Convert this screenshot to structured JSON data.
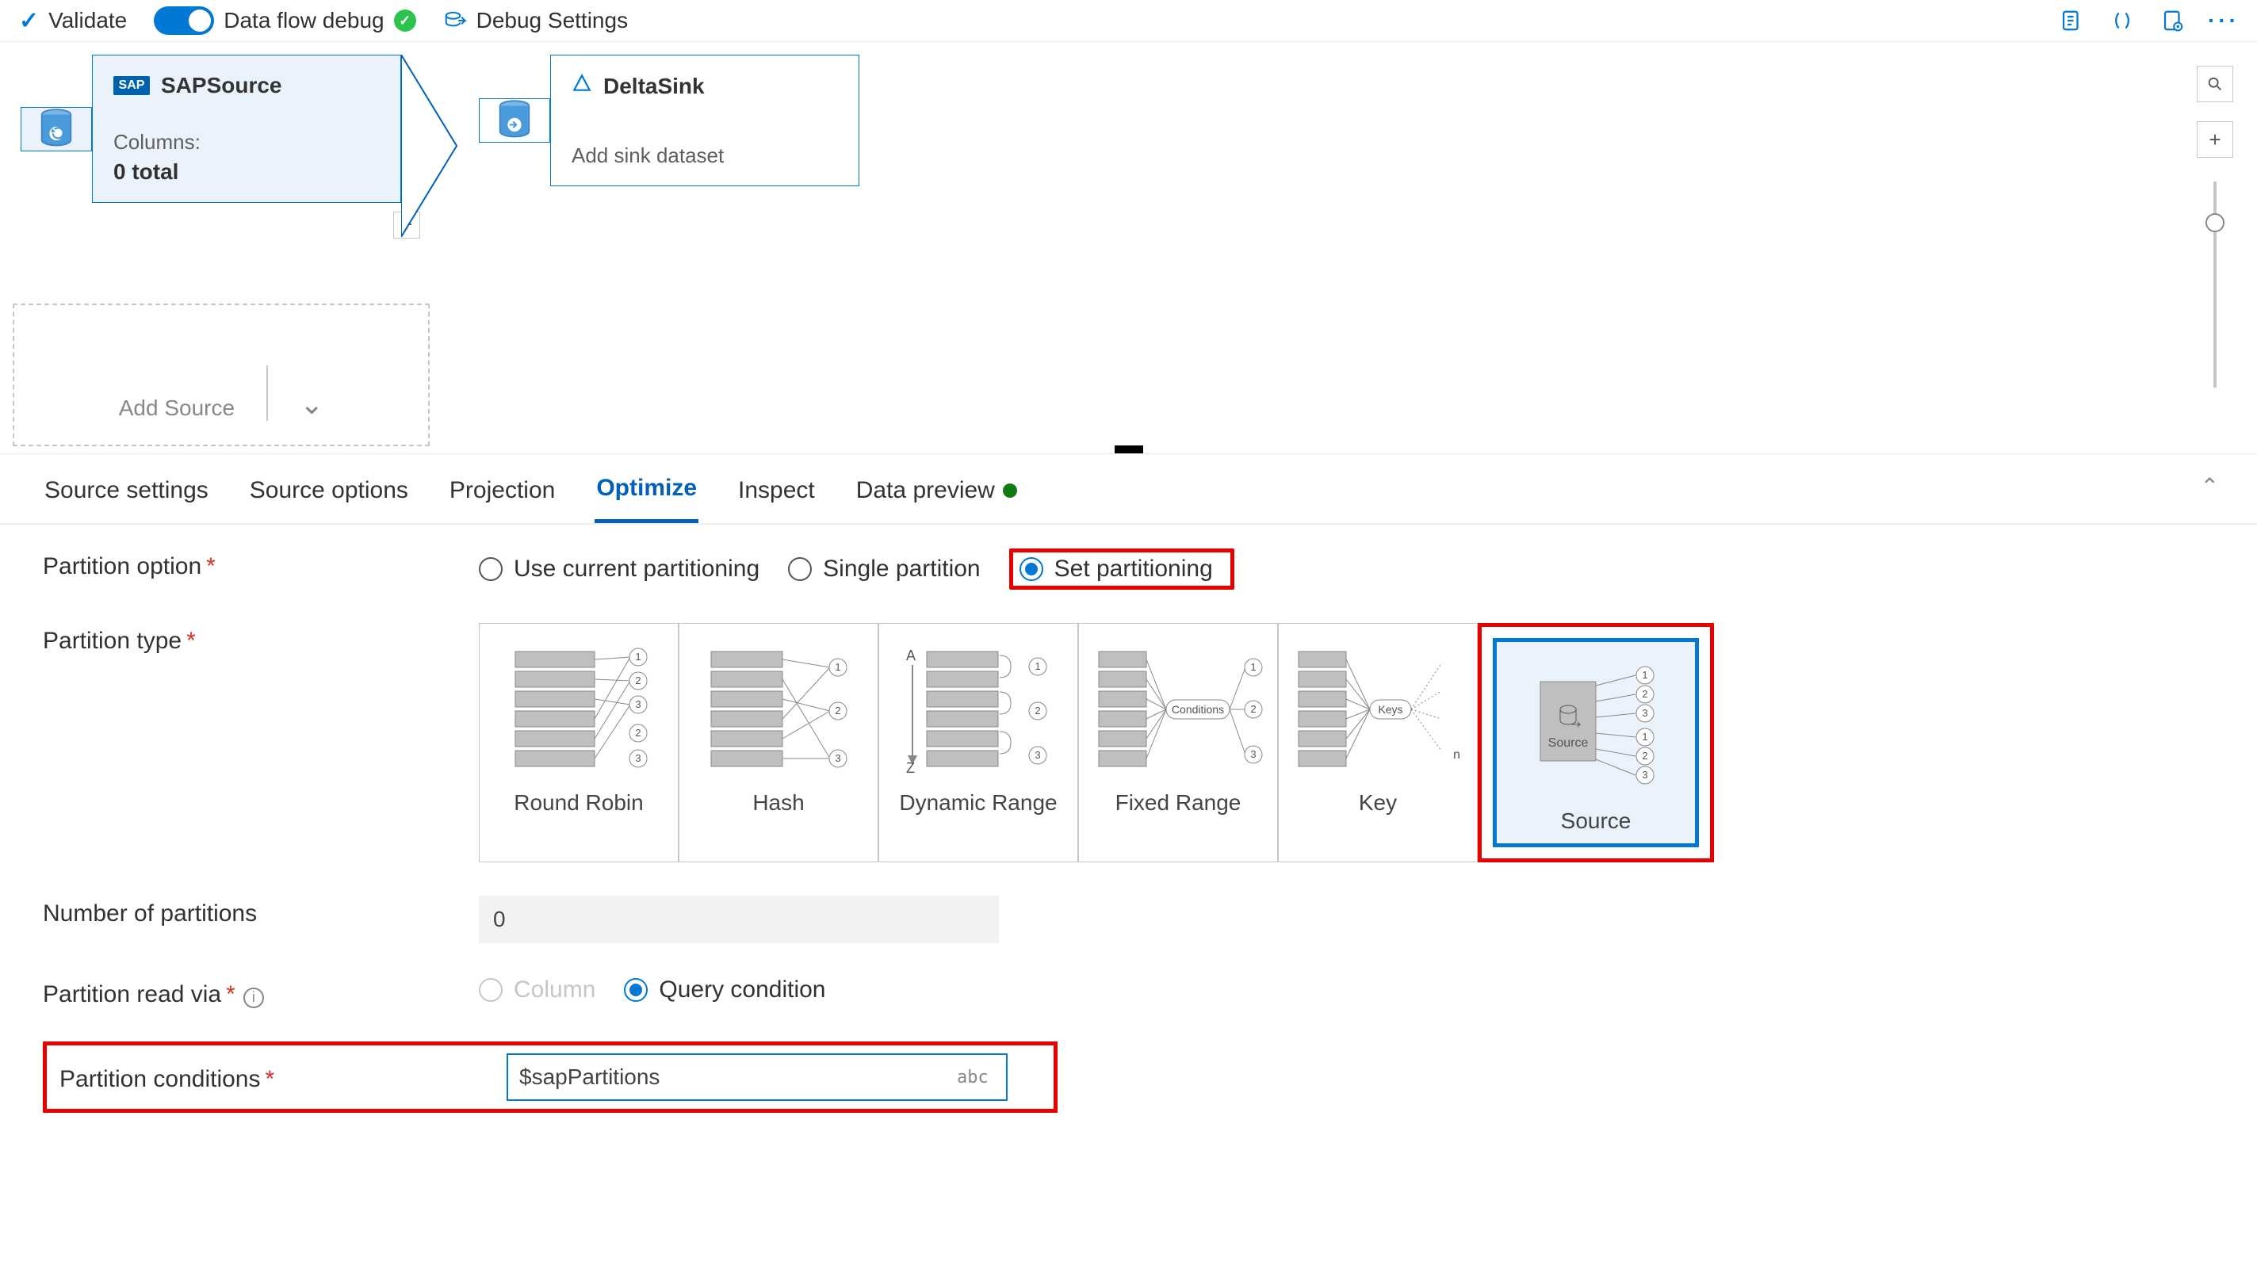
{
  "toolbar": {
    "validate": "Validate",
    "debug_label": "Data flow debug",
    "debug_settings": "Debug Settings"
  },
  "canvas": {
    "sap": {
      "title": "SAPSource",
      "columns_label": "Columns:",
      "total": "0 total"
    },
    "sink": {
      "title": "DeltaSink",
      "sub": "Add sink dataset"
    },
    "add_source": "Add Source"
  },
  "tabs": {
    "source_settings": "Source settings",
    "source_options": "Source options",
    "projection": "Projection",
    "optimize": "Optimize",
    "inspect": "Inspect",
    "data_preview": "Data preview"
  },
  "form": {
    "partition_option": {
      "label": "Partition option",
      "opts": {
        "use": "Use current partitioning",
        "single": "Single partition",
        "set": "Set partitioning"
      }
    },
    "partition_type": {
      "label": "Partition type",
      "tiles": [
        "Round Robin",
        "Hash",
        "Dynamic Range",
        "Fixed Range",
        "Key",
        "Source"
      ]
    },
    "num_partitions": {
      "label": "Number of partitions",
      "value": "0"
    },
    "read_via": {
      "label": "Partition read via",
      "opts": {
        "column": "Column",
        "query": "Query condition"
      }
    },
    "conditions": {
      "label": "Partition conditions",
      "value": "$sapPartitions",
      "suffix": "abc"
    }
  }
}
